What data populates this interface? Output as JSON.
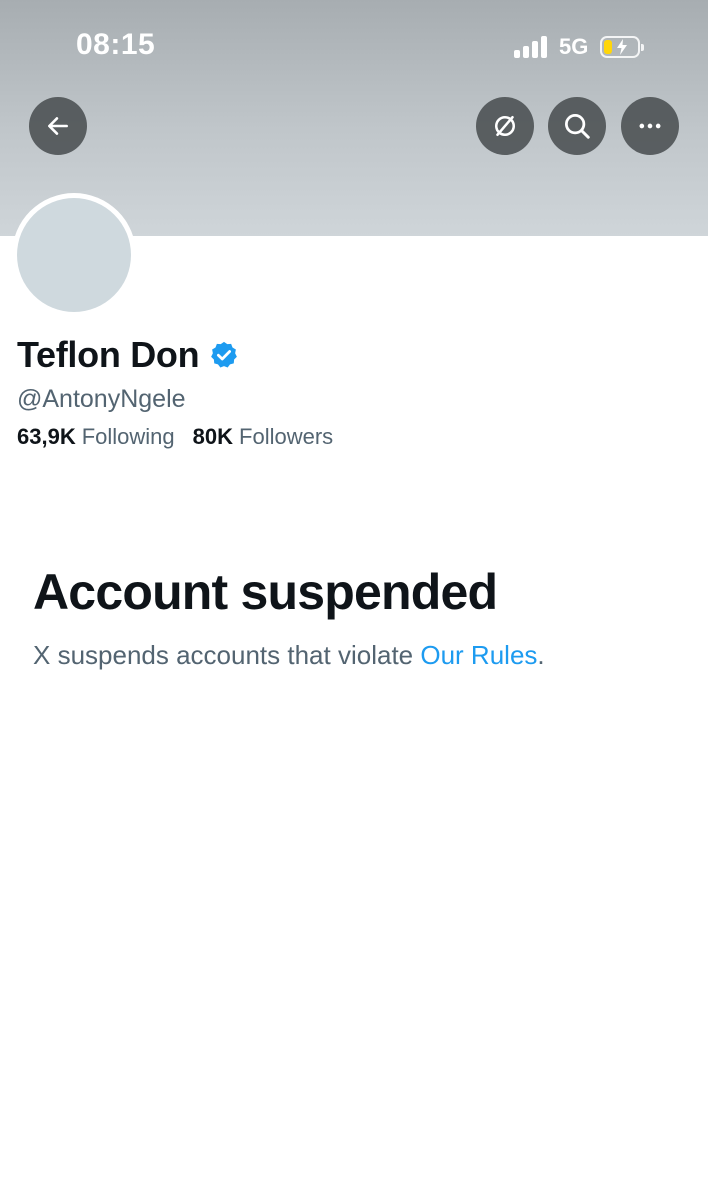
{
  "status_bar": {
    "time": "08:15",
    "network": "5G",
    "battery_level": 0.25
  },
  "header": {
    "back": "back-arrow-icon",
    "unfollow": "unfollow-icon",
    "search": "search-icon",
    "more": "more-icon"
  },
  "profile": {
    "display_name": "Teflon Don",
    "verified": true,
    "handle": "@AntonyNgele",
    "following_count": "63,9K",
    "following_label": "Following",
    "followers_count": "80K",
    "followers_label": "Followers"
  },
  "suspension": {
    "title": "Account suspended",
    "message": "X suspends accounts that violate ",
    "link_text": "Our Rules",
    "suffix": "."
  },
  "colors": {
    "accent": "#1d9bf0",
    "text": "#0f1419",
    "muted": "#536471",
    "battery": "#ffd60a"
  }
}
